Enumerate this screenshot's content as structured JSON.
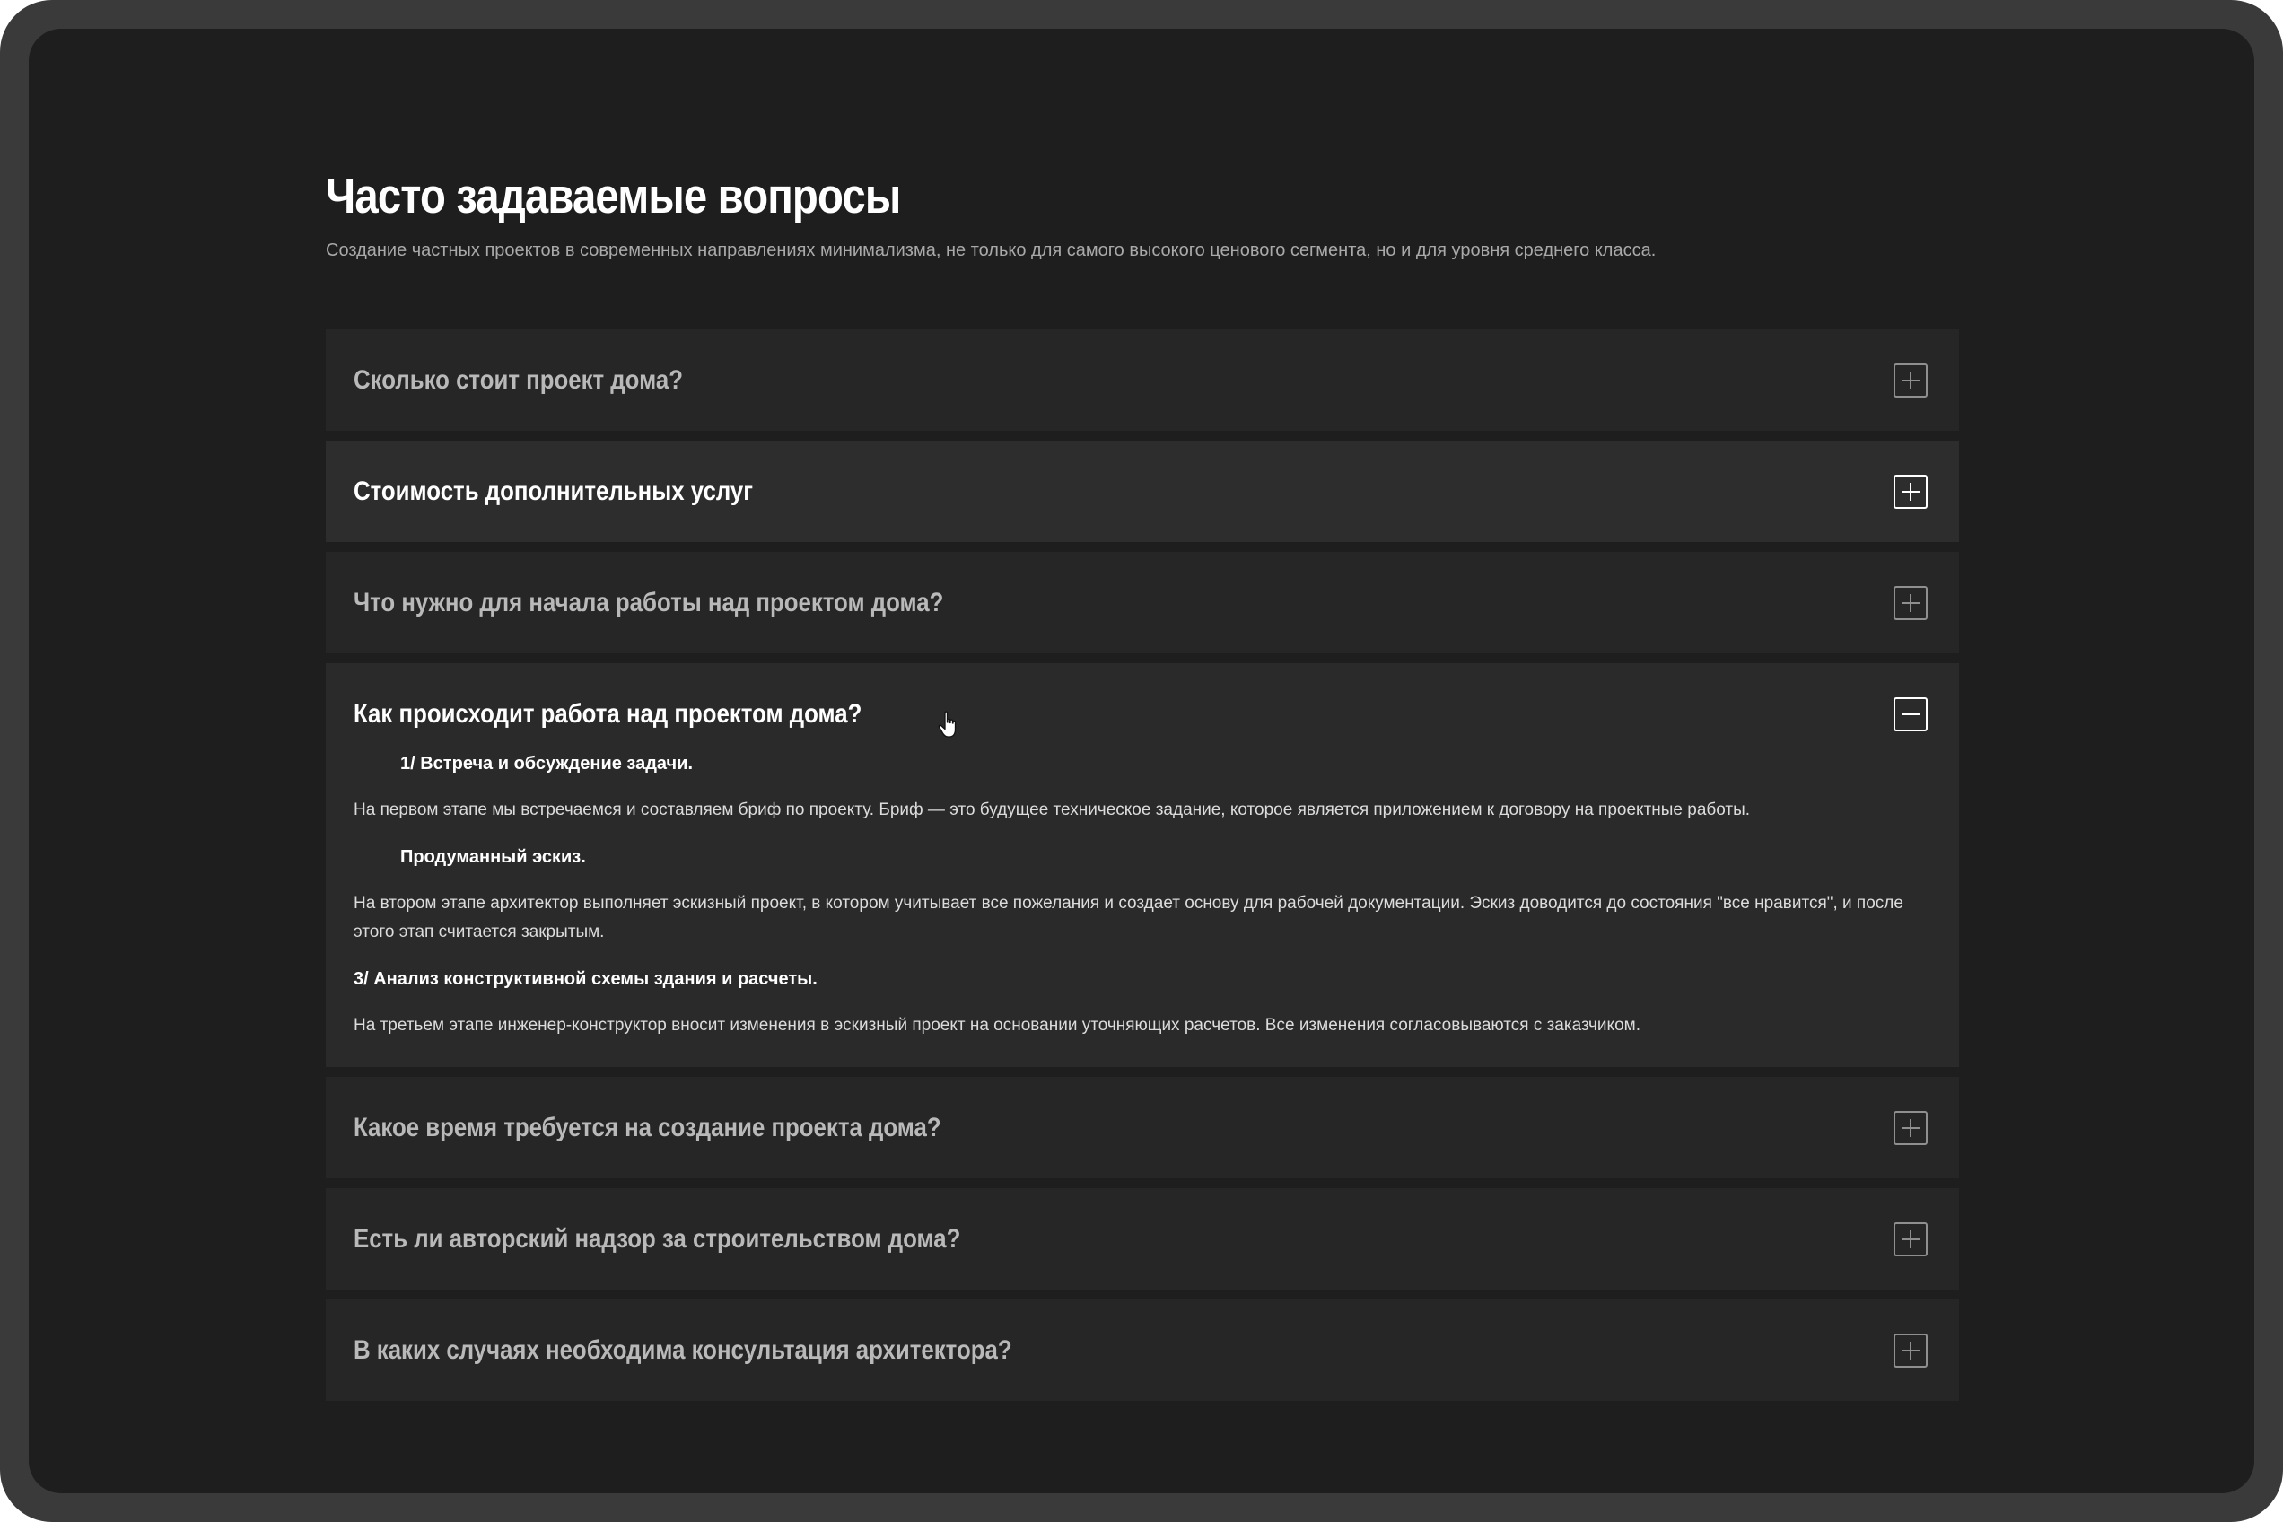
{
  "page": {
    "title": "Часто задаваемые вопросы",
    "subtitle": "Создание частных проектов в современных направлениях минимализма, не только для самого высокого ценового сегмента, но и для уровня среднего класса."
  },
  "faq": {
    "items": [
      {
        "question": "Сколько стоит проект дома?",
        "state": "collapsed",
        "toggle_icon": "plus-icon"
      },
      {
        "question": "Стоимость дополнительных услуг",
        "state": "collapsed-hover",
        "toggle_icon": "plus-icon"
      },
      {
        "question": "Что нужно для начала работы над проектом дома?",
        "state": "collapsed",
        "toggle_icon": "plus-icon"
      },
      {
        "question": "Как происходит работа над проектом дома?",
        "state": "expanded",
        "toggle_icon": "minus-icon",
        "answer": {
          "steps": [
            {
              "title": "1/ Встреча и обсуждение задачи.",
              "text": "На первом этапе мы встречаемся и составляем бриф по проекту. Бриф — это будущее техническое задание, которое является приложением к договору на проектные работы."
            },
            {
              "title": "Продуманный эскиз.",
              "text": "На втором этапе архитектор выполняет эскизный проект, в котором учитывает все пожелания и создает основу для рабочей документации. Эскиз доводится до состояния \"все нравится\", и после этого этап считается закрытым."
            },
            {
              "title": "3/ Анализ конструктивной схемы здания и расчеты.",
              "text": "На третьем этапе инженер-конструктор вносит изменения в эскизный проект на основании уточняющих расчетов. Все изменения согласовываются с заказчиком."
            }
          ]
        }
      },
      {
        "question": "Какое время требуется на создание проекта дома?",
        "state": "collapsed",
        "toggle_icon": "plus-icon"
      },
      {
        "question": "Есть ли авторский надзор за строительством дома?",
        "state": "collapsed",
        "toggle_icon": "plus-icon"
      },
      {
        "question": "В каких случаях необходима  консультация архитектора?",
        "state": "collapsed",
        "toggle_icon": "plus-icon"
      }
    ]
  },
  "colors": {
    "frame": "#3a3a3a",
    "background": "#1e1e1e",
    "card": "#262626",
    "card_active": "#2d2d2d",
    "text_primary": "#ffffff",
    "text_muted": "#b9b9b9"
  },
  "cursor_icon": "hand-pointer-icon"
}
